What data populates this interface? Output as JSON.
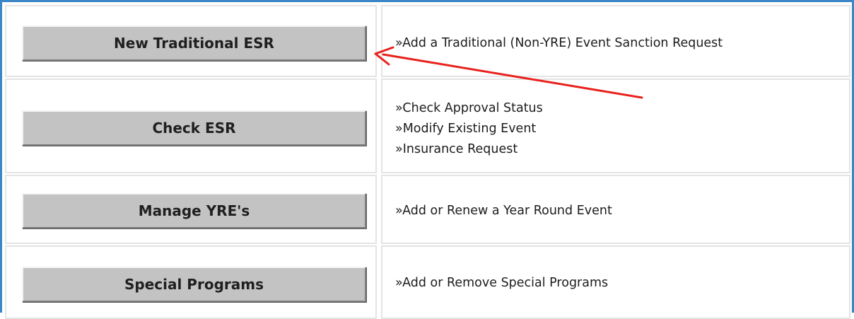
{
  "rows": [
    {
      "button_label": "New Traditional ESR",
      "description_lines": [
        "»Add a Traditional (Non-YRE) Event Sanction Request"
      ]
    },
    {
      "button_label": "Check ESR",
      "description_lines": [
        "»Check Approval Status",
        "»Modify Existing Event",
        "»Insurance Request"
      ]
    },
    {
      "button_label": "Manage YRE's",
      "description_lines": [
        "»Add or Renew a Year Round Event"
      ]
    },
    {
      "button_label": "Special Programs",
      "description_lines": [
        "»Add or Remove Special Programs"
      ]
    }
  ],
  "annotation": {
    "color": "#e8211b",
    "type": "arrow"
  },
  "colors": {
    "frame_border": "#3a86c8",
    "button_face": "#c3c3c3",
    "cell_border": "#e4e4e4"
  }
}
